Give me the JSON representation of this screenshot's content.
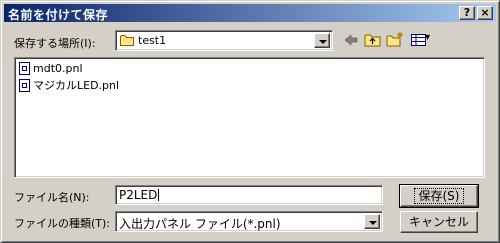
{
  "window": {
    "title": "名前を付けて保存",
    "help_button": "?",
    "close_button": "×"
  },
  "save_in": {
    "label": "保存する場所(I):",
    "folder": "test1"
  },
  "toolbar": {
    "back_icon": "back-arrow-icon",
    "up_icon": "up-folder-icon",
    "new_folder_icon": "new-folder-icon",
    "view_menu_icon": "view-menu-icon",
    "view_dropdown": "▾"
  },
  "files": [
    {
      "name": "mdt0.pnl",
      "icon": "panel-file-icon"
    },
    {
      "name": "マジカルLED.pnl",
      "icon": "panel-file-icon"
    }
  ],
  "filename": {
    "label": "ファイル名(N):",
    "value": "P2LED"
  },
  "filetype": {
    "label": "ファイルの種類(T):",
    "value": "入出力パネル ファイル(*.pnl)"
  },
  "buttons": {
    "save": "保存(S)",
    "cancel": "キャンセル"
  }
}
